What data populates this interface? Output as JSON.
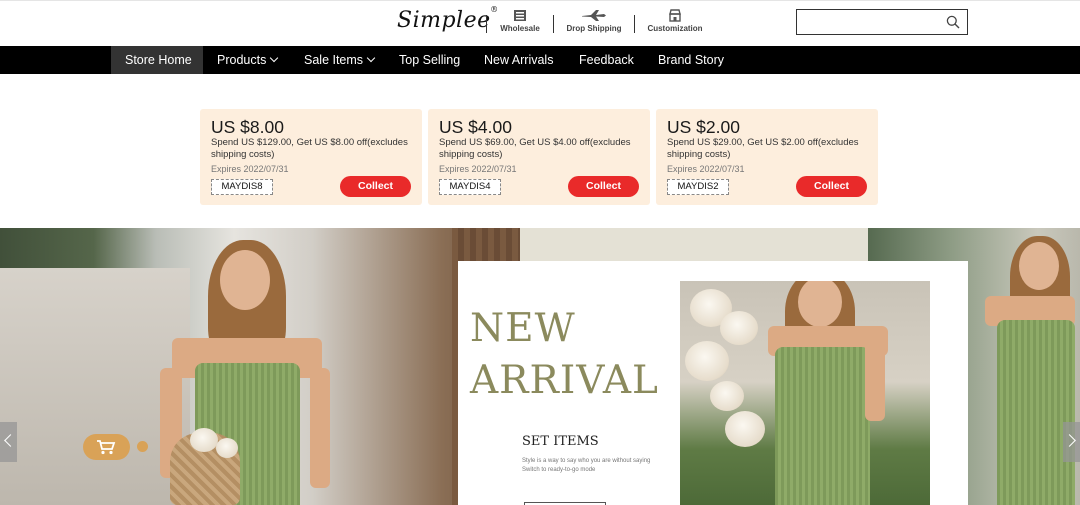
{
  "header": {
    "brand": "Simplee",
    "brand_mark": "®",
    "links": [
      {
        "label": "Wholesale",
        "icon": "wholesale-icon"
      },
      {
        "label": "Drop Shipping",
        "icon": "airplane-icon"
      },
      {
        "label": "Customization",
        "icon": "shop-icon"
      }
    ],
    "search": {
      "placeholder": "",
      "icon": "search-icon"
    }
  },
  "nav": {
    "items": [
      {
        "label": "Store Home",
        "active": true
      },
      {
        "label": "Products",
        "dropdown": true
      },
      {
        "label": "Sale Items",
        "dropdown": true
      },
      {
        "label": "Top Selling"
      },
      {
        "label": "New Arrivals"
      },
      {
        "label": "Feedback"
      },
      {
        "label": "Brand Story"
      }
    ]
  },
  "coupons": [
    {
      "amount": "US $8.00",
      "desc": "Spend US $129.00, Get US $8.00 off(excludes shipping costs)",
      "expires": "Expires 2022/07/31",
      "code": "MAYDIS8",
      "button": "Collect"
    },
    {
      "amount": "US $4.00",
      "desc": "Spend US $69.00, Get US $4.00 off(excludes shipping costs)",
      "expires": "Expires 2022/07/31",
      "code": "MAYDIS4",
      "button": "Collect"
    },
    {
      "amount": "US $2.00",
      "desc": "Spend US $29.00, Get US $2.00 off(excludes shipping costs)",
      "expires": "Expires 2022/07/31",
      "code": "MAYDIS2",
      "button": "Collect"
    }
  ],
  "banner": {
    "headline_1": "NEW",
    "headline_2": "ARRIVAL",
    "subhead": "SET ITEMS",
    "subtext_1": "Style is a way to say who you are without saying",
    "subtext_2": "Switch to ready-to-go mode"
  },
  "colors": {
    "nav_bg": "#000000",
    "nav_active": "#333333",
    "coupon_bg": "#fdeedd",
    "collect_button": "#e92a2a",
    "headline": "#8b8a5d",
    "cart_pill": "#d9a257"
  }
}
